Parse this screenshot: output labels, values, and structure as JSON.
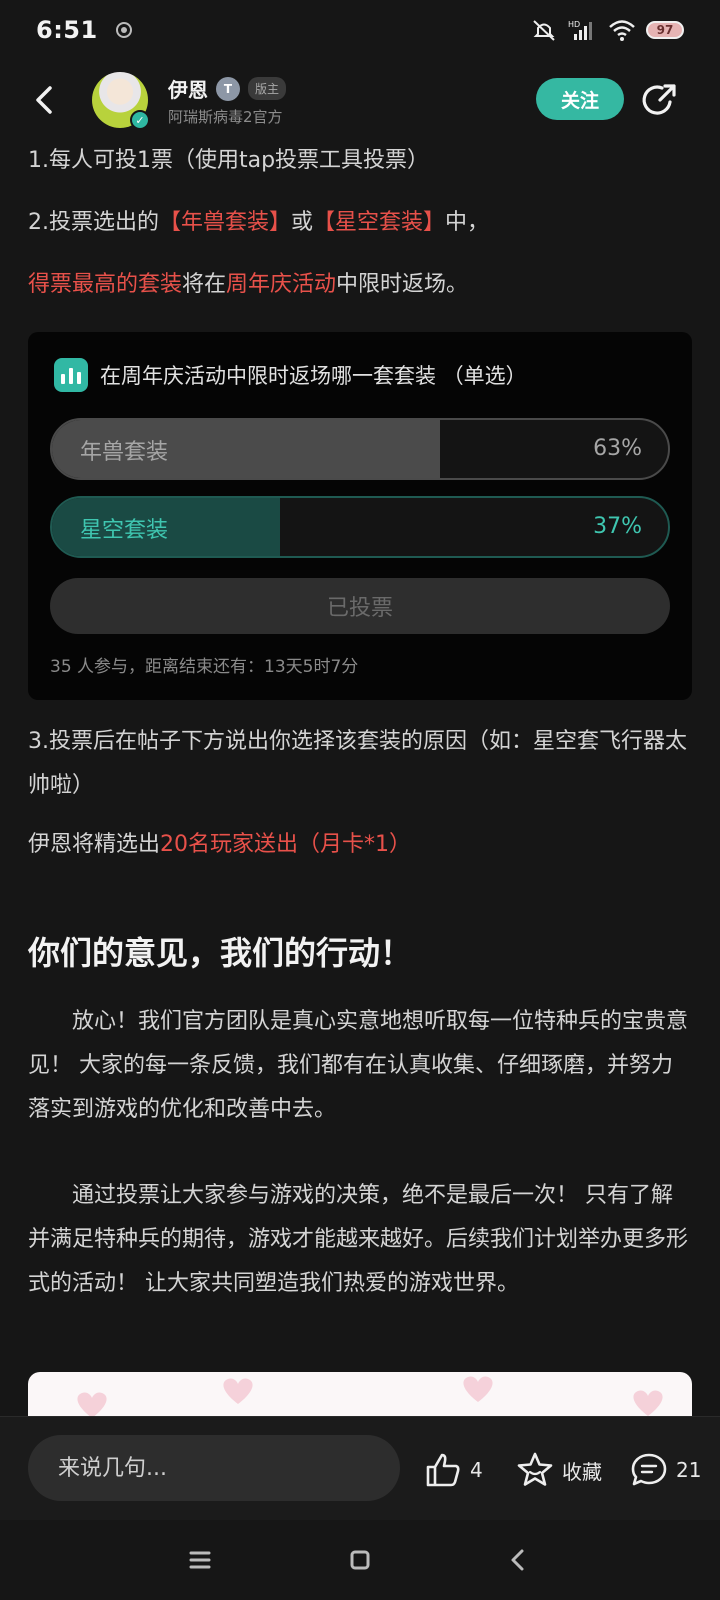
{
  "status_bar": {
    "time": "6:51",
    "battery": "97"
  },
  "header": {
    "username": "伊恩",
    "level_badge": "T",
    "role_badge": "版主",
    "subtitle": "阿瑞斯病毒2官方",
    "follow_label": "关注"
  },
  "post": {
    "line1": "1.每人可投1票（使用tap投票工具投票）",
    "line2": {
      "a": "2.投票选出的",
      "b": "【年兽套装】",
      "c": "或",
      "d": "【星空套装】",
      "e": "中，"
    },
    "line3": {
      "a": "得票最高的套装",
      "b": "将在",
      "c": "周年庆活动",
      "d": "中限时返场。"
    },
    "line4": "3.投票后在帖子下方说出你选择该套装的原因（如：星空套飞行器太帅啦）",
    "line5": {
      "a": "伊恩将精选出",
      "b": "20名玩家送出（月卡*1）"
    },
    "heading": "你们的意见，我们的行动！",
    "para1": "放心！我们官方团队是真心实意地想听取每一位特种兵的宝贵意见！ 大家的每一条反馈，我们都有在认真收集、仔细琢磨，并努力落实到游戏的优化和改善中去。",
    "para2": "通过投票让大家参与游戏的决策，绝不是最后一次！ 只有了解并满足特种兵的期待，游戏才能越来越好。后续我们计划举办更多形式的活动！ 让大家共同塑造我们热爱的游戏世界。"
  },
  "poll": {
    "title": "在周年庆活动中限时返场哪一套套装 （单选）",
    "options": [
      {
        "label": "年兽套装",
        "percent_text": "63%",
        "fraction": 0.63
      },
      {
        "label": "星空套装",
        "percent_text": "37%",
        "fraction": 0.37
      }
    ],
    "voted_label": "已投票",
    "meta": "35 人参与，距离结束还有：13天5时7分"
  },
  "bottom_bar": {
    "comment_placeholder": "来说几句...",
    "like_count": "4",
    "favorite_label": "收藏",
    "comment_count": "21"
  },
  "colors": {
    "accent": "#35b8a2",
    "highlight_red": "#e8514a"
  }
}
